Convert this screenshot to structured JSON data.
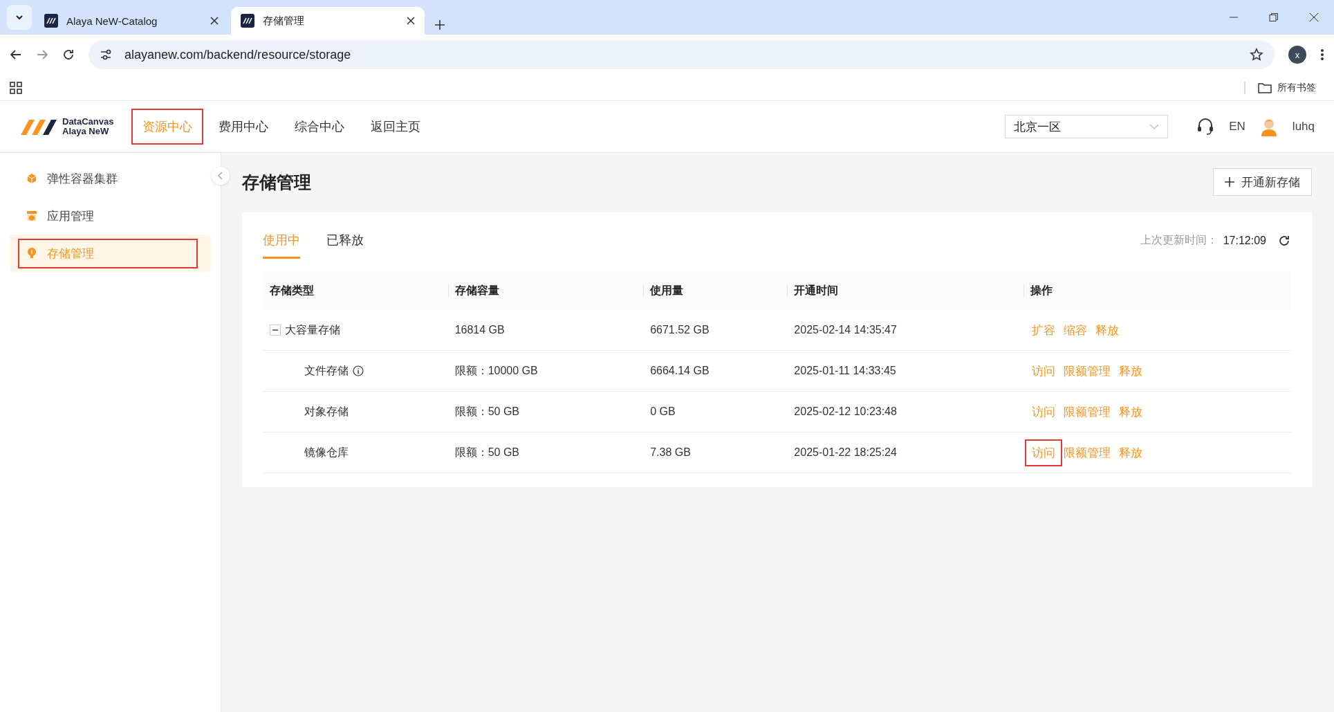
{
  "browser": {
    "tabs": [
      {
        "title": "Alaya NeW-Catalog",
        "selected": false
      },
      {
        "title": "存储管理",
        "selected": true
      }
    ],
    "url": "alayanew.com/backend/resource/storage",
    "bookmarks_label": "所有书签",
    "profile_initial": "x"
  },
  "header": {
    "logo_lines": [
      "DataCanvas",
      "Alaya NeW"
    ],
    "nav": [
      {
        "label": "资源中心",
        "selected": true,
        "highlighted": true
      },
      {
        "label": "费用中心",
        "selected": false,
        "highlighted": false
      },
      {
        "label": "综合中心",
        "selected": false,
        "highlighted": false
      },
      {
        "label": "返回主页",
        "selected": false,
        "highlighted": false
      }
    ],
    "region": "北京一区",
    "language": "EN",
    "user": "luhq"
  },
  "sidebar": {
    "items": [
      {
        "label": "弹性容器集群",
        "selected": false,
        "highlighted": false
      },
      {
        "label": "应用管理",
        "selected": false,
        "highlighted": false
      },
      {
        "label": "存储管理",
        "selected": true,
        "highlighted": true
      }
    ]
  },
  "page": {
    "title": "存储管理",
    "new_button": "开通新存储",
    "tabs": [
      {
        "label": "使用中",
        "selected": true
      },
      {
        "label": "已释放",
        "selected": false
      }
    ],
    "last_updated_label": "上次更新时间：",
    "last_updated": "17:12:09"
  },
  "table": {
    "columns": [
      "存储类型",
      "存储容量",
      "使用量",
      "开通时间",
      "操作"
    ],
    "rows": [
      {
        "name": "大容量存储",
        "capacity": "16814 GB",
        "usage": "6671.52 GB",
        "opened": "2025-02-14 14:35:47",
        "expanded": true,
        "has_info": false,
        "actions": [
          {
            "label": "扩容",
            "highlighted": false
          },
          {
            "label": "缩容",
            "highlighted": false
          },
          {
            "label": "释放",
            "highlighted": false
          }
        ],
        "children": [
          {
            "name": "文件存储",
            "capacity": "限额：10000 GB",
            "usage": "6664.14 GB",
            "opened": "2025-01-11 14:33:45",
            "has_info": true,
            "actions": [
              {
                "label": "访问",
                "highlighted": false
              },
              {
                "label": "限额管理",
                "highlighted": false
              },
              {
                "label": "释放",
                "highlighted": false
              }
            ]
          },
          {
            "name": "对象存储",
            "capacity": "限额：50 GB",
            "usage": "0 GB",
            "opened": "2025-02-12 10:23:48",
            "has_info": false,
            "actions": [
              {
                "label": "访问",
                "highlighted": false
              },
              {
                "label": "限额管理",
                "highlighted": false
              },
              {
                "label": "释放",
                "highlighted": false
              }
            ]
          },
          {
            "name": "镜像仓库",
            "capacity": "限额：50 GB",
            "usage": "7.38 GB",
            "opened": "2025-01-22 18:25:24",
            "has_info": false,
            "actions": [
              {
                "label": "访问",
                "highlighted": true
              },
              {
                "label": "限额管理",
                "highlighted": false
              },
              {
                "label": "释放",
                "highlighted": false
              }
            ]
          }
        ]
      }
    ]
  }
}
